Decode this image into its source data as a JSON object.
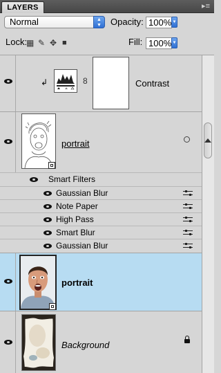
{
  "panel": {
    "tab_label": "LAYERS",
    "menu_glyph": "▸≡"
  },
  "controls": {
    "blend_mode": "Normal",
    "opacity_label": "Opacity:",
    "opacity_value": "100%",
    "lock_label": "Lock:",
    "fill_label": "Fill:",
    "fill_value": "100%"
  },
  "layers": {
    "contrast": {
      "name": "Contrast",
      "clip_glyph": "↲",
      "link_glyph": "8"
    },
    "portrait_sketch": {
      "name": "portrait"
    },
    "smart_filters": {
      "label": "Smart Filters",
      "items": [
        "Gaussian Blur",
        "Note Paper",
        "High Pass",
        "Smart Blur",
        "Gaussian Blur"
      ]
    },
    "portrait": {
      "name": "portrait"
    },
    "background": {
      "name": "Background"
    }
  },
  "colors": {
    "selection": "#b7dcf2",
    "accent": "#2f6fd3"
  },
  "icons": [
    "eye-icon",
    "lock-icon",
    "brush-icon",
    "move-icon",
    "link-icon",
    "smart-object-icon",
    "filter-options-icon"
  ]
}
